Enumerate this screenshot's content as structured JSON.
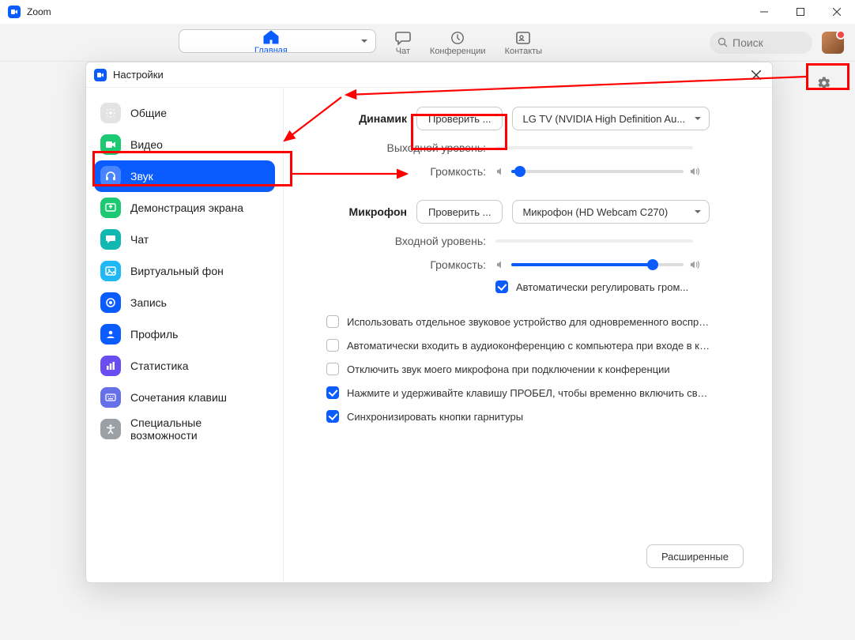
{
  "window": {
    "title": "Zoom"
  },
  "toolbar": {
    "home": "Главная",
    "chat": "Чат",
    "meetings": "Конференции",
    "contacts": "Контакты",
    "search_placeholder": "Поиск"
  },
  "modal": {
    "title": "Настройки",
    "advanced_button": "Расширенные"
  },
  "sidebar": {
    "items": [
      {
        "label": "Общие"
      },
      {
        "label": "Видео"
      },
      {
        "label": "Звук"
      },
      {
        "label": "Демонстрация экрана"
      },
      {
        "label": "Чат"
      },
      {
        "label": "Виртуальный фон"
      },
      {
        "label": "Запись"
      },
      {
        "label": "Профиль"
      },
      {
        "label": "Статистика"
      },
      {
        "label": "Сочетания клавиш"
      },
      {
        "label": "Специальные возможности"
      }
    ]
  },
  "audio": {
    "speaker_label": "Динамик",
    "speaker_test": "Проверить ...",
    "speaker_device": "LG TV (NVIDIA High Definition Au...",
    "output_level": "Выходной уровень:",
    "speaker_volume_label": "Громкость:",
    "speaker_volume_pct": 5,
    "mic_label": "Микрофон",
    "mic_test": "Проверить ...",
    "mic_device": "Микрофон (HD Webcam C270)",
    "input_level": "Входной уровень:",
    "mic_volume_label": "Громкость:",
    "mic_volume_pct": 82,
    "auto_adjust": "Автоматически регулировать гром...",
    "checks": [
      {
        "on": false,
        "label": "Использовать отдельное звуковое устройство для одновременного воспро..."
      },
      {
        "on": false,
        "label": "Автоматически входить в аудиоконференцию с компьютера при входе в кон..."
      },
      {
        "on": false,
        "label": "Отключить звук моего микрофона при подключении к конференции"
      },
      {
        "on": true,
        "label": "Нажмите и удерживайте клавишу ПРОБЕЛ, чтобы временно включить свой з..."
      },
      {
        "on": true,
        "label": "Синхронизировать кнопки гарнитуры"
      }
    ]
  }
}
